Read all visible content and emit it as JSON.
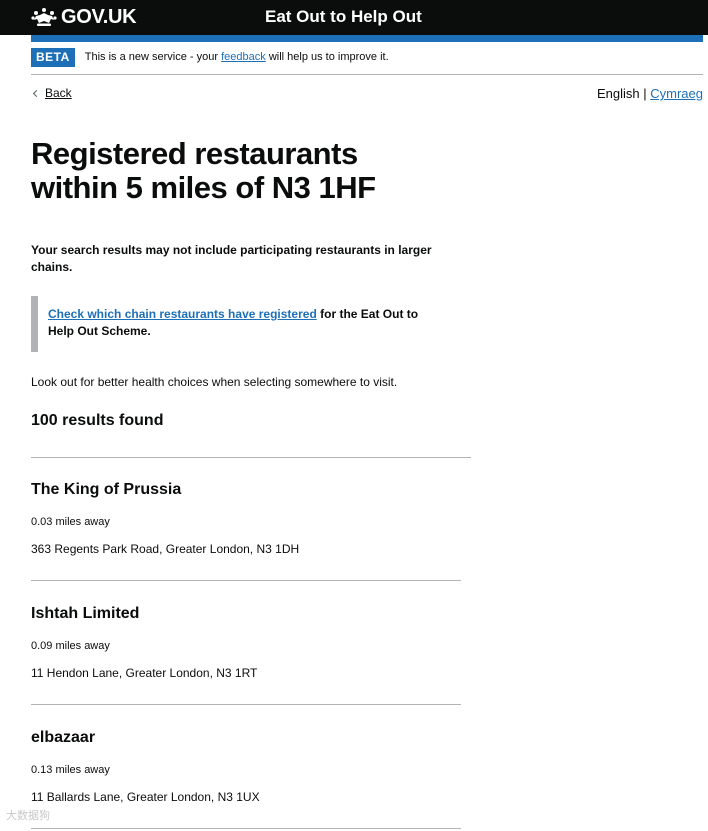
{
  "header": {
    "logo_text": "GOV.UK",
    "service_name": "Eat Out to Help Out"
  },
  "phase": {
    "tag": "BETA",
    "text_before": "This is a new service - your ",
    "link": "feedback",
    "text_after": " will help us to improve it."
  },
  "nav": {
    "back": "Back",
    "lang_current": "English",
    "lang_separator": "|",
    "lang_other": "Cymraeg"
  },
  "main": {
    "title_line1": "Registered restaurants",
    "title_line2": "within 5 miles of N3 1HF",
    "warning_line1": "Your search results may not include participating restaurants in larger",
    "warning_line2": "chains.",
    "inset_link": "Check which chain restaurants have registered",
    "inset_text1": " for the Eat Out to",
    "inset_text2": "Help Out Scheme.",
    "lookout": "Look out for better health choices when selecting somewhere to visit.",
    "results_count": "100 results found"
  },
  "results": [
    {
      "name": "The King of Prussia",
      "distance": "0.03 miles away",
      "address": "363 Regents Park Road, Greater London, N3 1DH"
    },
    {
      "name": "Ishtah Limited",
      "distance": "0.09 miles away",
      "address": "11 Hendon Lane, Greater London, N3 1RT"
    },
    {
      "name": "elbazaar",
      "distance": "0.13 miles away",
      "address": "11 Ballards Lane, Greater London, N3 1UX"
    }
  ],
  "watermark": "大数据狗"
}
